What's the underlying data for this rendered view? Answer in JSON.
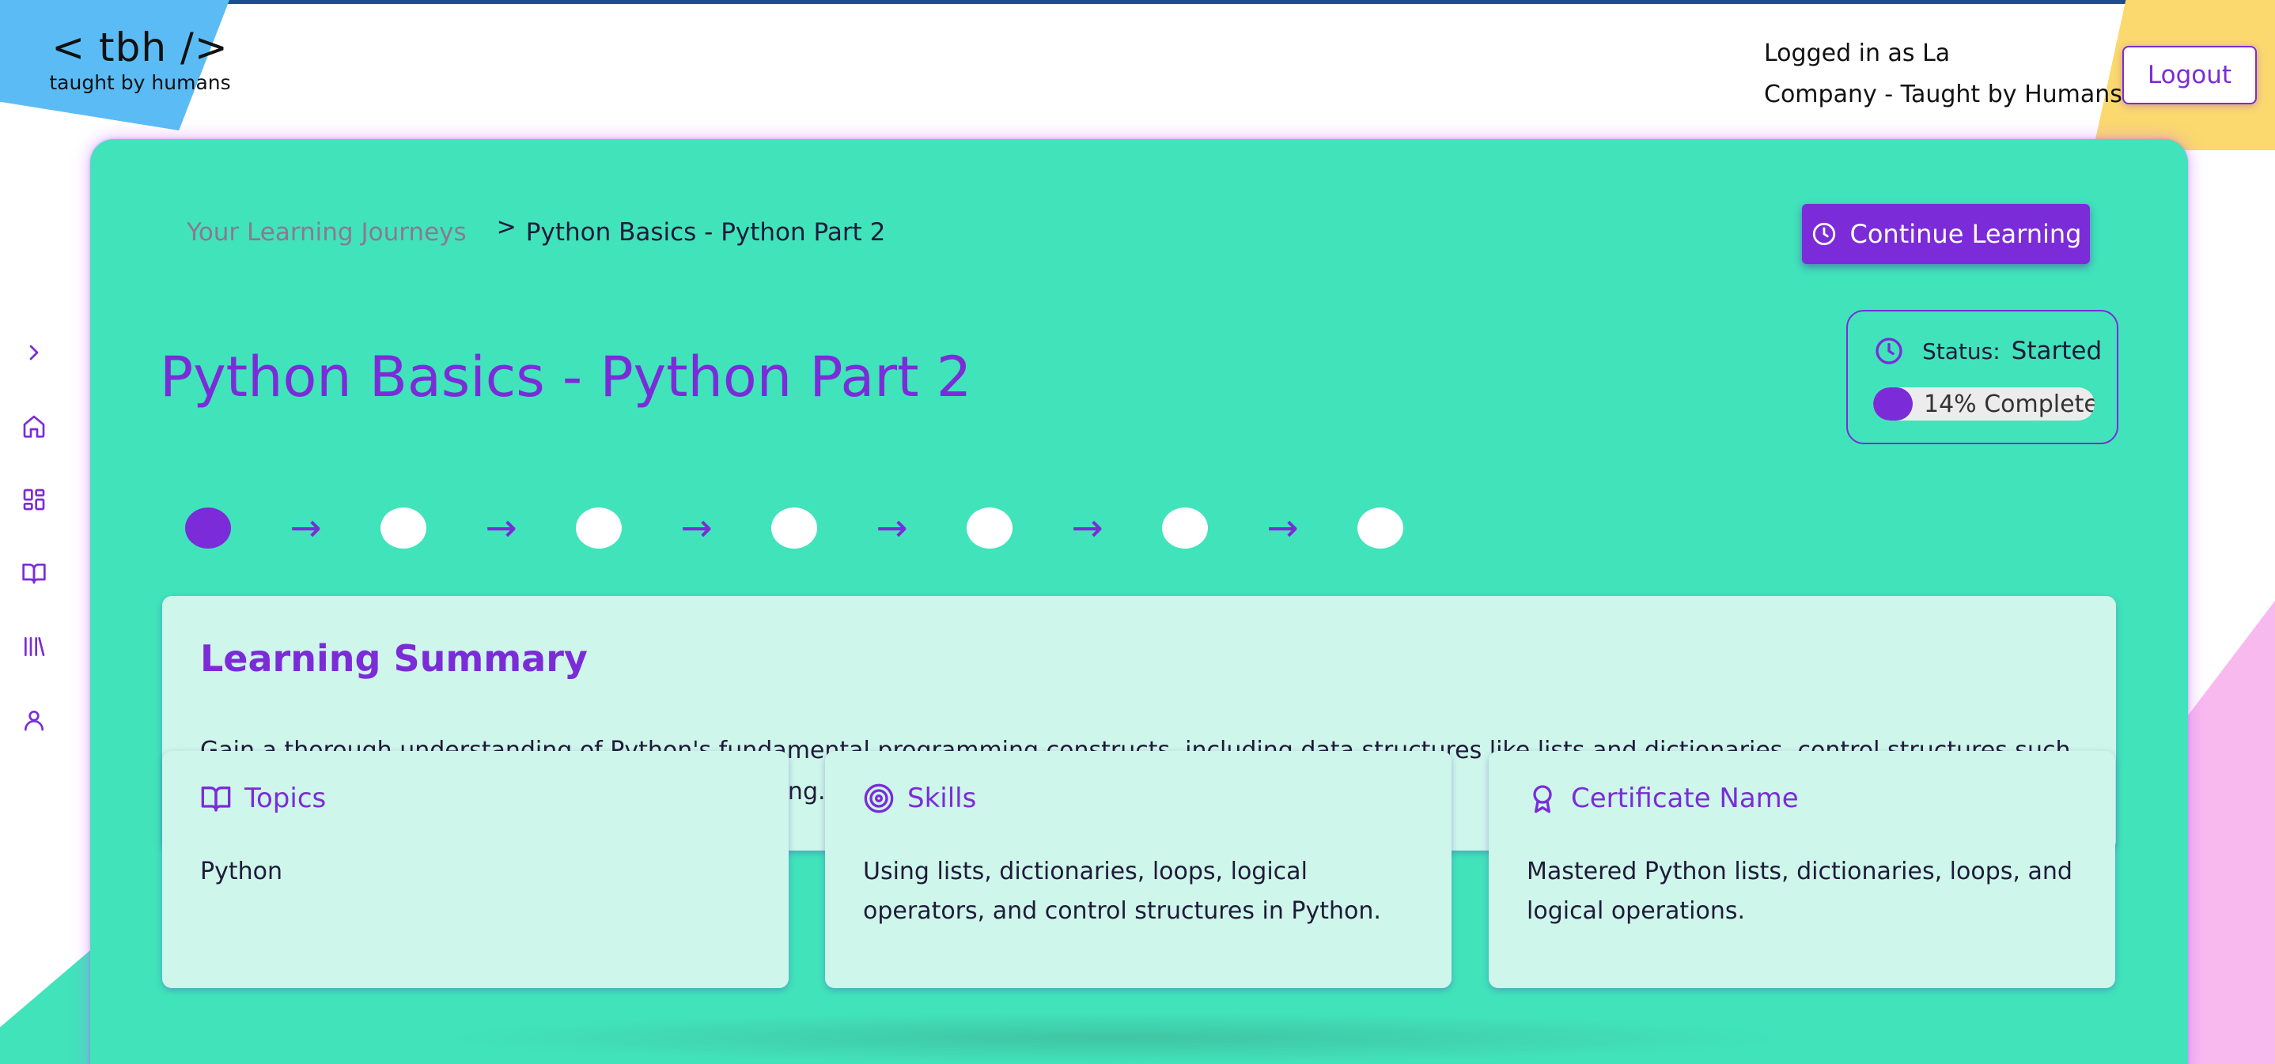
{
  "header": {
    "logo_mark": "< tbh />",
    "logo_tagline": "taught by humans",
    "logged_in": "Logged in as La",
    "company": "Company - Taught by Humans",
    "logout_label": "Logout"
  },
  "sidebar": {
    "items": [
      {
        "icon": "chevron-right-icon"
      },
      {
        "icon": "home-icon"
      },
      {
        "icon": "dashboard-icon"
      },
      {
        "icon": "book-open-icon"
      },
      {
        "icon": "library-icon"
      },
      {
        "icon": "user-icon"
      }
    ]
  },
  "breadcrumb": {
    "parent": "Your Learning Journeys",
    "separator": ">",
    "current": "Python Basics - Python Part 2"
  },
  "actions": {
    "continue_label": "Continue Learning"
  },
  "page": {
    "title": "Python Basics - Python Part 2"
  },
  "status": {
    "label": "Status:",
    "value": "Started",
    "progress_percent": 14,
    "progress_text": "14% Complete"
  },
  "steps": {
    "total": 7,
    "current": 1,
    "arrow": "→"
  },
  "summary": {
    "title": "Learning Summary",
    "text": "Gain a thorough understanding of Python's fundamental programming constructs, including data structures like lists and dictionaries, control structures such as loops, and logical operations for decision-making."
  },
  "cards": [
    {
      "icon": "book-open-icon",
      "title": "Topics",
      "body": "Python"
    },
    {
      "icon": "target-icon",
      "title": "Skills",
      "body": "Using lists, dictionaries, loops, logical operators, and control structures in Python."
    },
    {
      "icon": "award-icon",
      "title": "Certificate Name",
      "body": "Mastered Python lists, dictionaries, loops, and logical operations."
    }
  ],
  "colors": {
    "accent": "#7b2cd8",
    "card_bg": "#41e3bb",
    "panel_bg": "#cef6ea"
  }
}
